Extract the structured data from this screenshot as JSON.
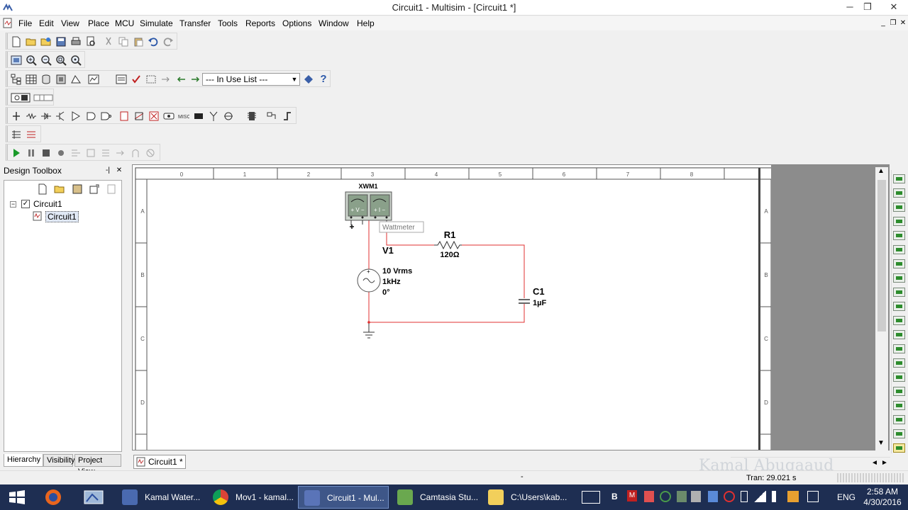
{
  "window": {
    "title": "Circuit1 - Multisim - [Circuit1 *]",
    "minimize": "─",
    "restore": "❐",
    "close": "✕"
  },
  "menu": {
    "items": [
      "File",
      "Edit",
      "View",
      "Place",
      "MCU",
      "Simulate",
      "Transfer",
      "Tools",
      "Reports",
      "Options",
      "Window",
      "Help"
    ],
    "mdi_minimize": "_",
    "mdi_restore": "❐",
    "mdi_close": "✕"
  },
  "toolbar": {
    "in_use_list": "--- In Use List ---",
    "help_glyph": "?"
  },
  "design_toolbox": {
    "title": "Design Toolbox",
    "pin": "-|",
    "close": "✕",
    "tree_root": "Circuit1",
    "tree_child": "Circuit1",
    "tabs": [
      "Hierarchy",
      "Visibility",
      "Project View"
    ]
  },
  "sheet": {
    "col_labels": [
      "0",
      "1",
      "2",
      "3",
      "4",
      "5",
      "6",
      "7",
      "8"
    ],
    "row_labels": [
      "A",
      "B",
      "C",
      "D"
    ],
    "tab_label": "Circuit1 *"
  },
  "circuit": {
    "wattmeter_ref": "XWM1",
    "wattmeter_terminals_v": "+ V −",
    "wattmeter_terminals_i": "+ I −",
    "tooltip": "Wattmeter",
    "source_ref": "V1",
    "source_value": "10 Vrms",
    "source_freq": "1kHz",
    "source_phase": "0°",
    "resistor_ref": "R1",
    "resistor_value": "120Ω",
    "capacitor_ref": "C1",
    "capacitor_value": "1µF",
    "wire_color": "#e03030"
  },
  "status": {
    "tran": "Tran: 29.021 s",
    "dash": "-"
  },
  "watermark": "Kamal Abuqaaud",
  "taskbar": {
    "apps": [
      {
        "label": "Kamal Water...",
        "icon": "watermark-app-icon"
      },
      {
        "label": "Mov1 - kamal...",
        "icon": "chrome-icon"
      },
      {
        "label": "Circuit1 - Mul...",
        "icon": "multisim-icon"
      },
      {
        "label": "Camtasia Stu...",
        "icon": "camtasia-icon"
      },
      {
        "label": "C:\\Users\\kab...",
        "icon": "folder-icon"
      }
    ],
    "lang": "ENG",
    "time": "2:58 AM",
    "date": "4/30/2016"
  }
}
